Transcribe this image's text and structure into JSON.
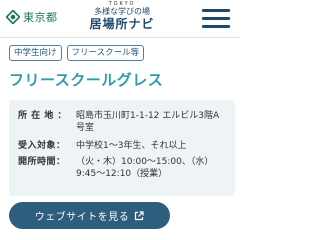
{
  "header": {
    "gov_name": "東京都",
    "site_logo": {
      "small": "TOKYO",
      "middle": "多様な学びの場",
      "big": "居場所ナビ"
    }
  },
  "tags": [
    "中学生向け",
    "フリースクール等"
  ],
  "title": "フリースクールグレス",
  "info": {
    "address_label": "所 在 地 ：",
    "address_value": "昭島市玉川町1-1-12 エルビル3階A号室",
    "target_label": "受入対象：",
    "target_value": "中学校1〜3年生、それ以上",
    "hours_label": "開所時間：",
    "hours_value": "（火・木）10:00〜15:00、（水）9:45〜12:10（授業）"
  },
  "cta": {
    "label": "ウェブサイトを見る"
  },
  "colors": {
    "gov_green": "#1d7a4a",
    "navy": "#1e4a6e",
    "title_teal": "#2f9bb0",
    "button": "#2e5e7e",
    "info_bg": "#eef3f6"
  },
  "icons": [
    "tokyo-gov-mark-icon",
    "hamburger-menu-icon",
    "external-link-icon"
  ]
}
